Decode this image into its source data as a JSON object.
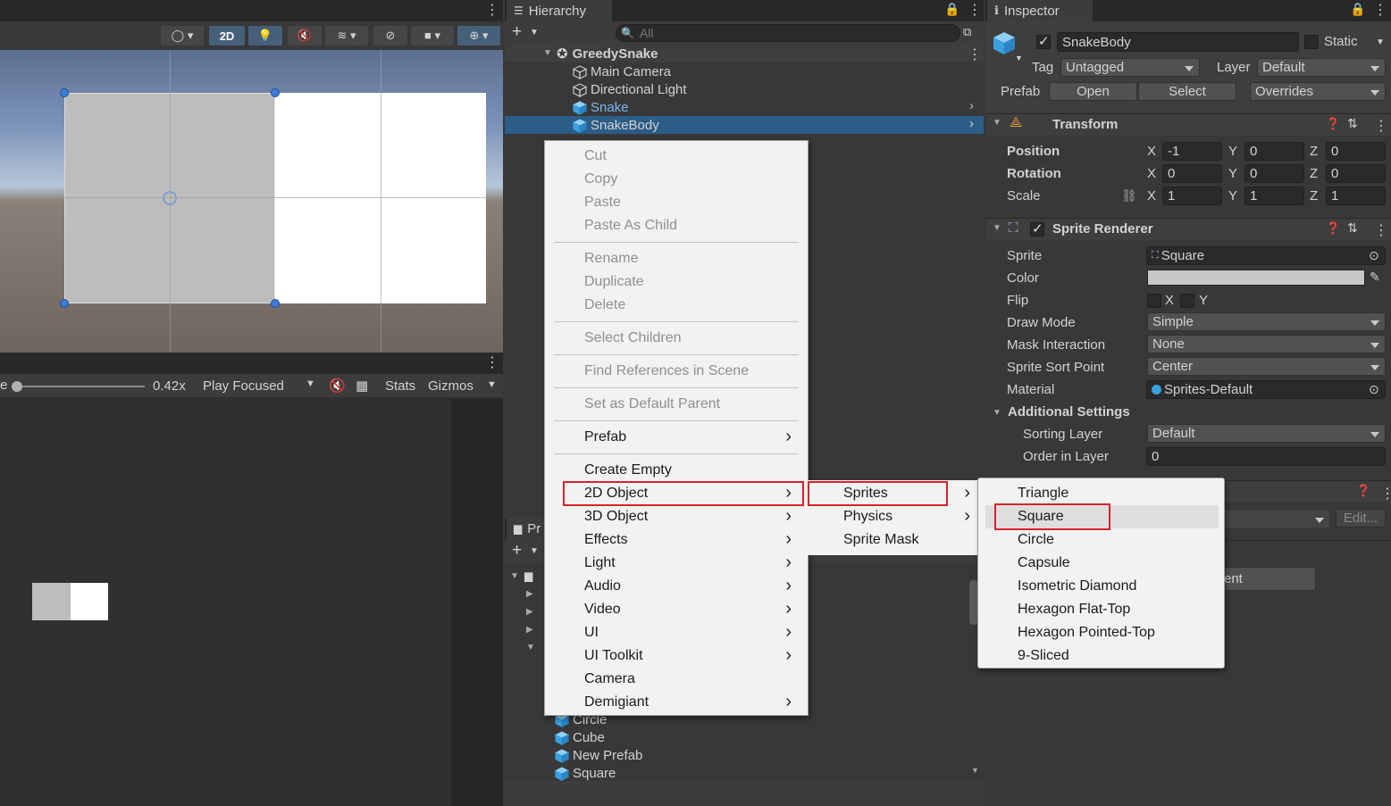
{
  "scene": {
    "toolbar": {
      "mode_2d": "2D"
    },
    "game_toolbar": {
      "scale_label": "e",
      "scale_value": "0.42x",
      "play_mode": "Play Focused",
      "stats": "Stats",
      "gizmos": "Gizmos"
    }
  },
  "hierarchy": {
    "tab": "Hierarchy",
    "search_placeholder": "All",
    "root": "GreedySnake",
    "items": [
      {
        "label": "Main Camera",
        "kind": "gameobject"
      },
      {
        "label": "Directional Light",
        "kind": "gameobject"
      },
      {
        "label": "Snake",
        "kind": "prefab"
      },
      {
        "label": "SnakeBody",
        "kind": "prefab"
      }
    ]
  },
  "project": {
    "tab": "Pr",
    "assets": [
      "Circle",
      "Cube",
      "New Prefab",
      "Square"
    ]
  },
  "inspector": {
    "tab": "Inspector",
    "object_name": "SnakeBody",
    "static_label": "Static",
    "tag_label": "Tag",
    "tag_value": "Untagged",
    "layer_label": "Layer",
    "layer_value": "Default",
    "prefab_label": "Prefab",
    "open": "Open",
    "select": "Select",
    "overrides": "Overrides",
    "transform": {
      "title": "Transform",
      "rows": [
        {
          "label": "Position",
          "x": "-1",
          "y": "0",
          "z": "0"
        },
        {
          "label": "Rotation",
          "x": "0",
          "y": "0",
          "z": "0"
        },
        {
          "label": "Scale",
          "x": "1",
          "y": "1",
          "z": "1"
        }
      ],
      "axis_x": "X",
      "axis_y": "Y",
      "axis_z": "Z"
    },
    "sprite_renderer": {
      "title": "Sprite Renderer",
      "sprite_label": "Sprite",
      "sprite_value": "Square",
      "color_label": "Color",
      "color_value": "#c8c8c8",
      "flip_label": "Flip",
      "flip_x": "X",
      "flip_y": "Y",
      "draw_mode_label": "Draw Mode",
      "draw_mode_value": "Simple",
      "mask_label": "Mask Interaction",
      "mask_value": "None",
      "sort_point_label": "Sprite Sort Point",
      "sort_point_value": "Center",
      "material_label": "Material",
      "material_value": "Sprites-Default",
      "additional_label": "Additional Settings",
      "sorting_layer_label": "Sorting Layer",
      "sorting_layer_value": "Default",
      "order_label": "Order in Layer",
      "order_value": "0"
    },
    "partial_edit": "Edit...",
    "partial_button": "ent"
  },
  "context_menu": {
    "groups": [
      [
        {
          "label": "Cut",
          "disabled": true
        },
        {
          "label": "Copy",
          "disabled": true
        },
        {
          "label": "Paste",
          "disabled": true
        },
        {
          "label": "Paste As Child",
          "disabled": true
        }
      ],
      [
        {
          "label": "Rename",
          "disabled": true
        },
        {
          "label": "Duplicate",
          "disabled": true
        },
        {
          "label": "Delete",
          "disabled": true
        }
      ],
      [
        {
          "label": "Select Children",
          "disabled": true
        }
      ],
      [
        {
          "label": "Find References in Scene",
          "disabled": true
        }
      ],
      [
        {
          "label": "Set as Default Parent",
          "disabled": true
        }
      ],
      [
        {
          "label": "Prefab",
          "submenu": true
        }
      ],
      [
        {
          "label": "Create Empty"
        },
        {
          "label": "2D Object",
          "submenu": true
        },
        {
          "label": "3D Object",
          "submenu": true
        },
        {
          "label": "Effects",
          "submenu": true
        },
        {
          "label": "Light",
          "submenu": true
        },
        {
          "label": "Audio",
          "submenu": true
        },
        {
          "label": "Video",
          "submenu": true
        },
        {
          "label": "UI",
          "submenu": true
        },
        {
          "label": "UI Toolkit",
          "submenu": true
        },
        {
          "label": "Camera"
        },
        {
          "label": "Demigiant",
          "submenu": true
        }
      ]
    ]
  },
  "submenu_2d": [
    "Sprites",
    "Physics",
    "Sprite Mask"
  ],
  "submenu_sprites": [
    "Triangle",
    "Square",
    "Circle",
    "Capsule",
    "Isometric Diamond",
    "Hexagon Flat-Top",
    "Hexagon Pointed-Top",
    "9-Sliced"
  ]
}
